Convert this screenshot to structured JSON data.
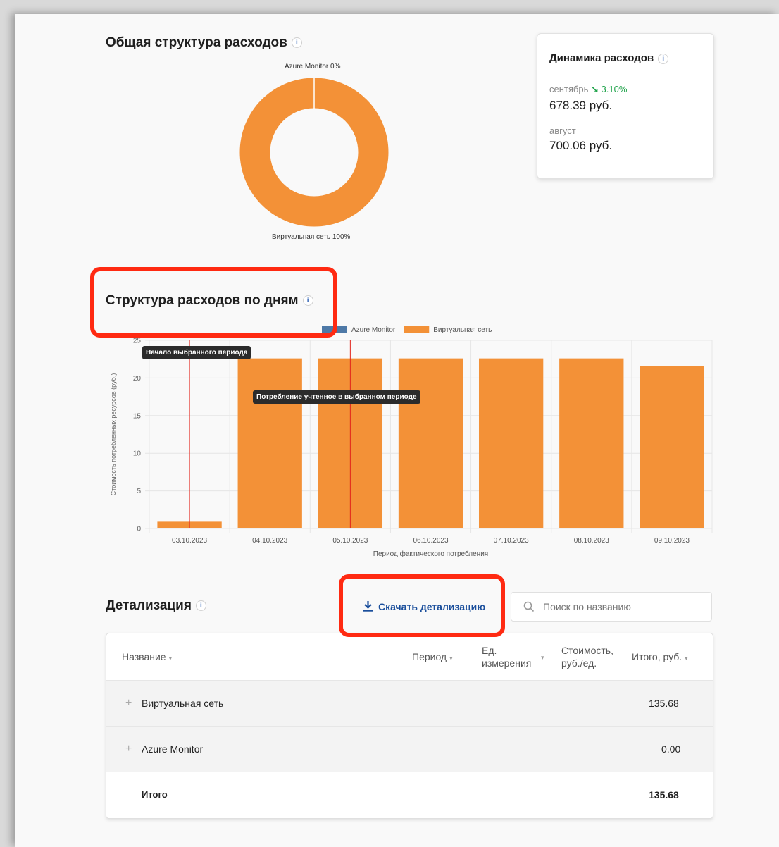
{
  "general": {
    "title": "Общая структура расходов",
    "info": "i"
  },
  "pie": {
    "top_label": "Azure Monitor 0%",
    "bottom_label": "Виртуальная сеть 100%",
    "color": "#f39137"
  },
  "dynamics": {
    "title": "Динамика расходов",
    "info": "i",
    "current_month": "сентябрь",
    "trend_arrow": "↘",
    "trend": "3.10%",
    "current_value": "678.39 руб.",
    "prev_month": "август",
    "prev_value": "700.06 руб."
  },
  "daily": {
    "title": "Структура расходов по дням",
    "info": "i"
  },
  "chart_data": {
    "type": "bar",
    "categories": [
      "03.10.2023",
      "04.10.2023",
      "05.10.2023",
      "06.10.2023",
      "07.10.2023",
      "08.10.2023",
      "09.10.2023"
    ],
    "series": [
      {
        "name": "Azure Monitor",
        "color": "#4e79a7",
        "values": [
          0,
          0,
          0,
          0,
          0,
          0,
          0
        ]
      },
      {
        "name": "Виртуальная сеть",
        "color": "#f39137",
        "values": [
          0.9,
          22.6,
          22.6,
          22.6,
          22.6,
          22.6,
          21.6
        ]
      }
    ],
    "xlabel": "Период фактического потребления",
    "ylabel": "Стоимость потребленных ресурсов (руб.)",
    "ylim": [
      0,
      25
    ],
    "yticks": [
      "0",
      "5",
      "10",
      "15",
      "20",
      "25"
    ],
    "grid": true,
    "legend": "top",
    "annotations": [
      "Начало выбранного периода",
      "Потребление учтенное в выбранном периоде"
    ]
  },
  "details": {
    "title": "Детализация",
    "info": "i",
    "download": "Скачать детализацию",
    "search_placeholder": "Поиск по названию",
    "columns": {
      "name": "Название",
      "period": "Период",
      "unit_1": "Ед.",
      "unit_2": "измерения",
      "cost_1": "Стоимость,",
      "cost_2": "руб./ед.",
      "total": "Итого, руб."
    },
    "rows": [
      {
        "name": "Виртуальная сеть",
        "total": "135.68"
      },
      {
        "name": "Azure Monitor",
        "total": "0.00"
      }
    ],
    "footer": {
      "label": "Итого",
      "total": "135.68"
    }
  }
}
